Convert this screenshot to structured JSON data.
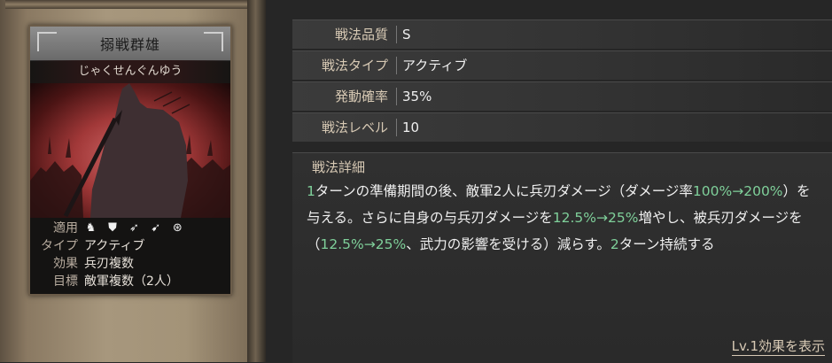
{
  "card": {
    "name": "搦戦群雄",
    "reading": "じゃくせんぐんゆう",
    "rows": {
      "apply_label": "適用",
      "type_label": "タイプ",
      "type_value": "アクティブ",
      "effect_label": "効果",
      "effect_value": "兵刃複数",
      "target_label": "目標",
      "target_value": "敵軍複数（2人）"
    },
    "apply_icons": [
      "cavalry-icon",
      "shield-icon",
      "bow-icon",
      "spear-icon",
      "wheel-icon"
    ]
  },
  "attributes": [
    {
      "label": "戦法品質",
      "value": "S"
    },
    {
      "label": "戦法タイプ",
      "value": "アクティブ"
    },
    {
      "label": "発動確率",
      "value": "35%"
    },
    {
      "label": "戦法レベル",
      "value": "10"
    }
  ],
  "detail": {
    "title": "戦法詳細",
    "segments": [
      {
        "t": "1",
        "hl": true
      },
      {
        "t": "ターンの準備期間の後、敵軍2人に兵刃ダメージ（ダメージ率",
        "hl": false
      },
      {
        "t": "100%→200%",
        "hl": true
      },
      {
        "t": "）を与える。さらに自身の与兵刃ダメージを",
        "hl": false
      },
      {
        "t": "12.5%→25%",
        "hl": true
      },
      {
        "t": "増やし、被兵刃ダメージを（",
        "hl": false
      },
      {
        "t": "12.5%→25%",
        "hl": true
      },
      {
        "t": "、武力の影響を受ける）減らす。",
        "hl": false
      },
      {
        "t": "2",
        "hl": true
      },
      {
        "t": "ターン持続する",
        "hl": false
      }
    ]
  },
  "lv1_link": "Lv.1効果を表示",
  "colors": {
    "highlight": "#7fd09a",
    "label": "#d7c9b4"
  }
}
